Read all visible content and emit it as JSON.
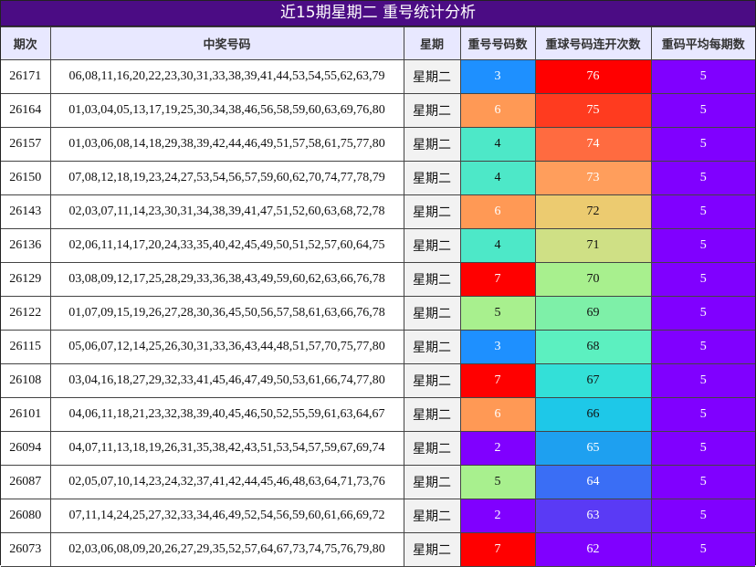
{
  "title": "近15期星期二 重号统计分析",
  "headers": [
    "期次",
    "中奖号码",
    "星期",
    "重号号码数",
    "重球号码连开次数",
    "重码平均每期数"
  ],
  "rows": [
    {
      "period": "26171",
      "numbers": "06,08,11,16,20,22,23,30,31,33,38,39,41,44,53,54,55,62,63,79",
      "weekday": "星期二",
      "repeat_count": "3",
      "repeat_streak": "76",
      "avg_repeat": "5",
      "repeat_color": "#1e90ff",
      "streak_color": "#ff0000"
    },
    {
      "period": "26164",
      "numbers": "01,03,04,05,13,17,19,25,30,34,38,46,56,58,59,60,63,69,76,80",
      "weekday": "星期二",
      "repeat_count": "6",
      "repeat_streak": "75",
      "avg_repeat": "5",
      "repeat_color": "#ff9955",
      "streak_color": "#ff3b1f"
    },
    {
      "period": "26157",
      "numbers": "01,03,06,08,14,18,29,38,39,42,44,46,49,51,57,58,61,75,77,80",
      "weekday": "星期二",
      "repeat_count": "4",
      "repeat_streak": "74",
      "avg_repeat": "5",
      "repeat_color": "#4de8c8",
      "streak_color": "#ff6b40"
    },
    {
      "period": "26150",
      "numbers": "07,08,12,18,19,23,24,27,53,54,56,57,59,60,62,70,74,77,78,79",
      "weekday": "星期二",
      "repeat_count": "4",
      "repeat_streak": "73",
      "avg_repeat": "5",
      "repeat_color": "#4de8c8",
      "streak_color": "#ff9e5c"
    },
    {
      "period": "26143",
      "numbers": "02,03,07,11,14,23,30,31,34,38,39,41,47,51,52,60,63,68,72,78",
      "weekday": "星期二",
      "repeat_count": "6",
      "repeat_streak": "72",
      "avg_repeat": "5",
      "repeat_color": "#ff9955",
      "streak_color": "#eccb70"
    },
    {
      "period": "26136",
      "numbers": "02,06,11,14,17,20,24,33,35,40,42,45,49,50,51,52,57,60,64,75",
      "weekday": "星期二",
      "repeat_count": "4",
      "repeat_streak": "71",
      "avg_repeat": "5",
      "repeat_color": "#4de8c8",
      "streak_color": "#cfe085"
    },
    {
      "period": "26129",
      "numbers": "03,08,09,12,17,25,28,29,33,36,38,43,49,59,60,62,63,66,76,78",
      "weekday": "星期二",
      "repeat_count": "7",
      "repeat_streak": "70",
      "avg_repeat": "5",
      "repeat_color": "#ff0000",
      "streak_color": "#a8f08e"
    },
    {
      "period": "26122",
      "numbers": "01,07,09,15,19,26,27,28,30,36,45,50,56,57,58,61,63,66,76,78",
      "weekday": "星期二",
      "repeat_count": "5",
      "repeat_streak": "69",
      "avg_repeat": "5",
      "repeat_color": "#a8f08e",
      "streak_color": "#7ef0a8"
    },
    {
      "period": "26115",
      "numbers": "05,06,07,12,14,25,26,30,31,33,36,43,44,48,51,57,70,75,77,80",
      "weekday": "星期二",
      "repeat_count": "3",
      "repeat_streak": "68",
      "avg_repeat": "5",
      "repeat_color": "#1e90ff",
      "streak_color": "#5cf0c0"
    },
    {
      "period": "26108",
      "numbers": "03,04,16,18,27,29,32,33,41,45,46,47,49,50,53,61,66,74,77,80",
      "weekday": "星期二",
      "repeat_count": "7",
      "repeat_streak": "67",
      "avg_repeat": "5",
      "repeat_color": "#ff0000",
      "streak_color": "#33e0d8"
    },
    {
      "period": "26101",
      "numbers": "04,06,11,18,21,23,32,38,39,40,45,46,50,52,55,59,61,63,64,67",
      "weekday": "星期二",
      "repeat_count": "6",
      "repeat_streak": "66",
      "avg_repeat": "5",
      "repeat_color": "#ff9955",
      "streak_color": "#1ec8e8"
    },
    {
      "period": "26094",
      "numbers": "04,07,11,13,18,19,26,31,35,38,42,43,51,53,54,57,59,67,69,74",
      "weekday": "星期二",
      "repeat_count": "2",
      "repeat_streak": "65",
      "avg_repeat": "5",
      "repeat_color": "#8000ff",
      "streak_color": "#1ea0f0"
    },
    {
      "period": "26087",
      "numbers": "02,05,07,10,14,23,24,32,37,41,42,44,45,46,48,63,64,71,73,76",
      "weekday": "星期二",
      "repeat_count": "5",
      "repeat_streak": "64",
      "avg_repeat": "5",
      "repeat_color": "#a8f08e",
      "streak_color": "#3a6ef5"
    },
    {
      "period": "26080",
      "numbers": "07,11,14,24,25,27,32,33,34,46,49,52,54,56,59,60,61,66,69,72",
      "weekday": "星期二",
      "repeat_count": "2",
      "repeat_streak": "63",
      "avg_repeat": "5",
      "repeat_color": "#8000ff",
      "streak_color": "#5a3af5"
    },
    {
      "period": "26073",
      "numbers": "02,03,06,08,09,20,26,27,29,35,52,57,64,67,73,74,75,76,79,80",
      "weekday": "星期二",
      "repeat_count": "7",
      "repeat_streak": "62",
      "avg_repeat": "5",
      "repeat_color": "#ff0000",
      "streak_color": "#8000ff"
    }
  ]
}
